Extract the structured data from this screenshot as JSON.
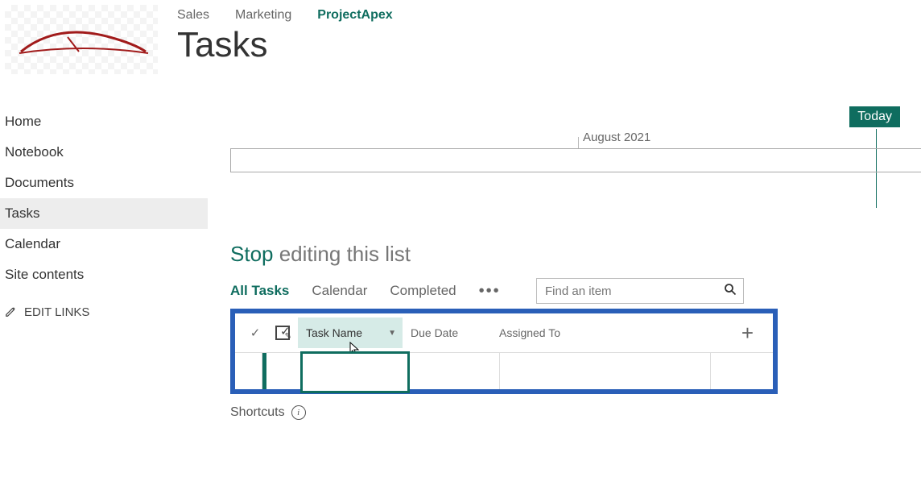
{
  "topnav": {
    "items": [
      {
        "label": "Sales",
        "active": false
      },
      {
        "label": "Marketing",
        "active": false
      },
      {
        "label": "ProjectApex",
        "active": true
      }
    ]
  },
  "page_title": "Tasks",
  "sidenav": {
    "items": [
      {
        "label": "Home"
      },
      {
        "label": "Notebook"
      },
      {
        "label": "Documents"
      },
      {
        "label": "Tasks",
        "active": true
      },
      {
        "label": "Calendar"
      },
      {
        "label": "Site contents"
      }
    ],
    "edit_links_label": "EDIT LINKS"
  },
  "timeline": {
    "today_label": "Today",
    "month_label": "August 2021"
  },
  "editing": {
    "stop_label": "Stop",
    "rest_label": " editing this list"
  },
  "views": {
    "tabs": [
      {
        "label": "All Tasks",
        "active": true
      },
      {
        "label": "Calendar"
      },
      {
        "label": "Completed"
      }
    ]
  },
  "search": {
    "placeholder": "Find an item"
  },
  "grid": {
    "columns": {
      "task_name": "Task Name",
      "due_date": "Due Date",
      "assigned_to": "Assigned To"
    },
    "row": {
      "task_name": "",
      "due_date": "",
      "assigned_to": ""
    }
  },
  "shortcuts_label": "Shortcuts"
}
